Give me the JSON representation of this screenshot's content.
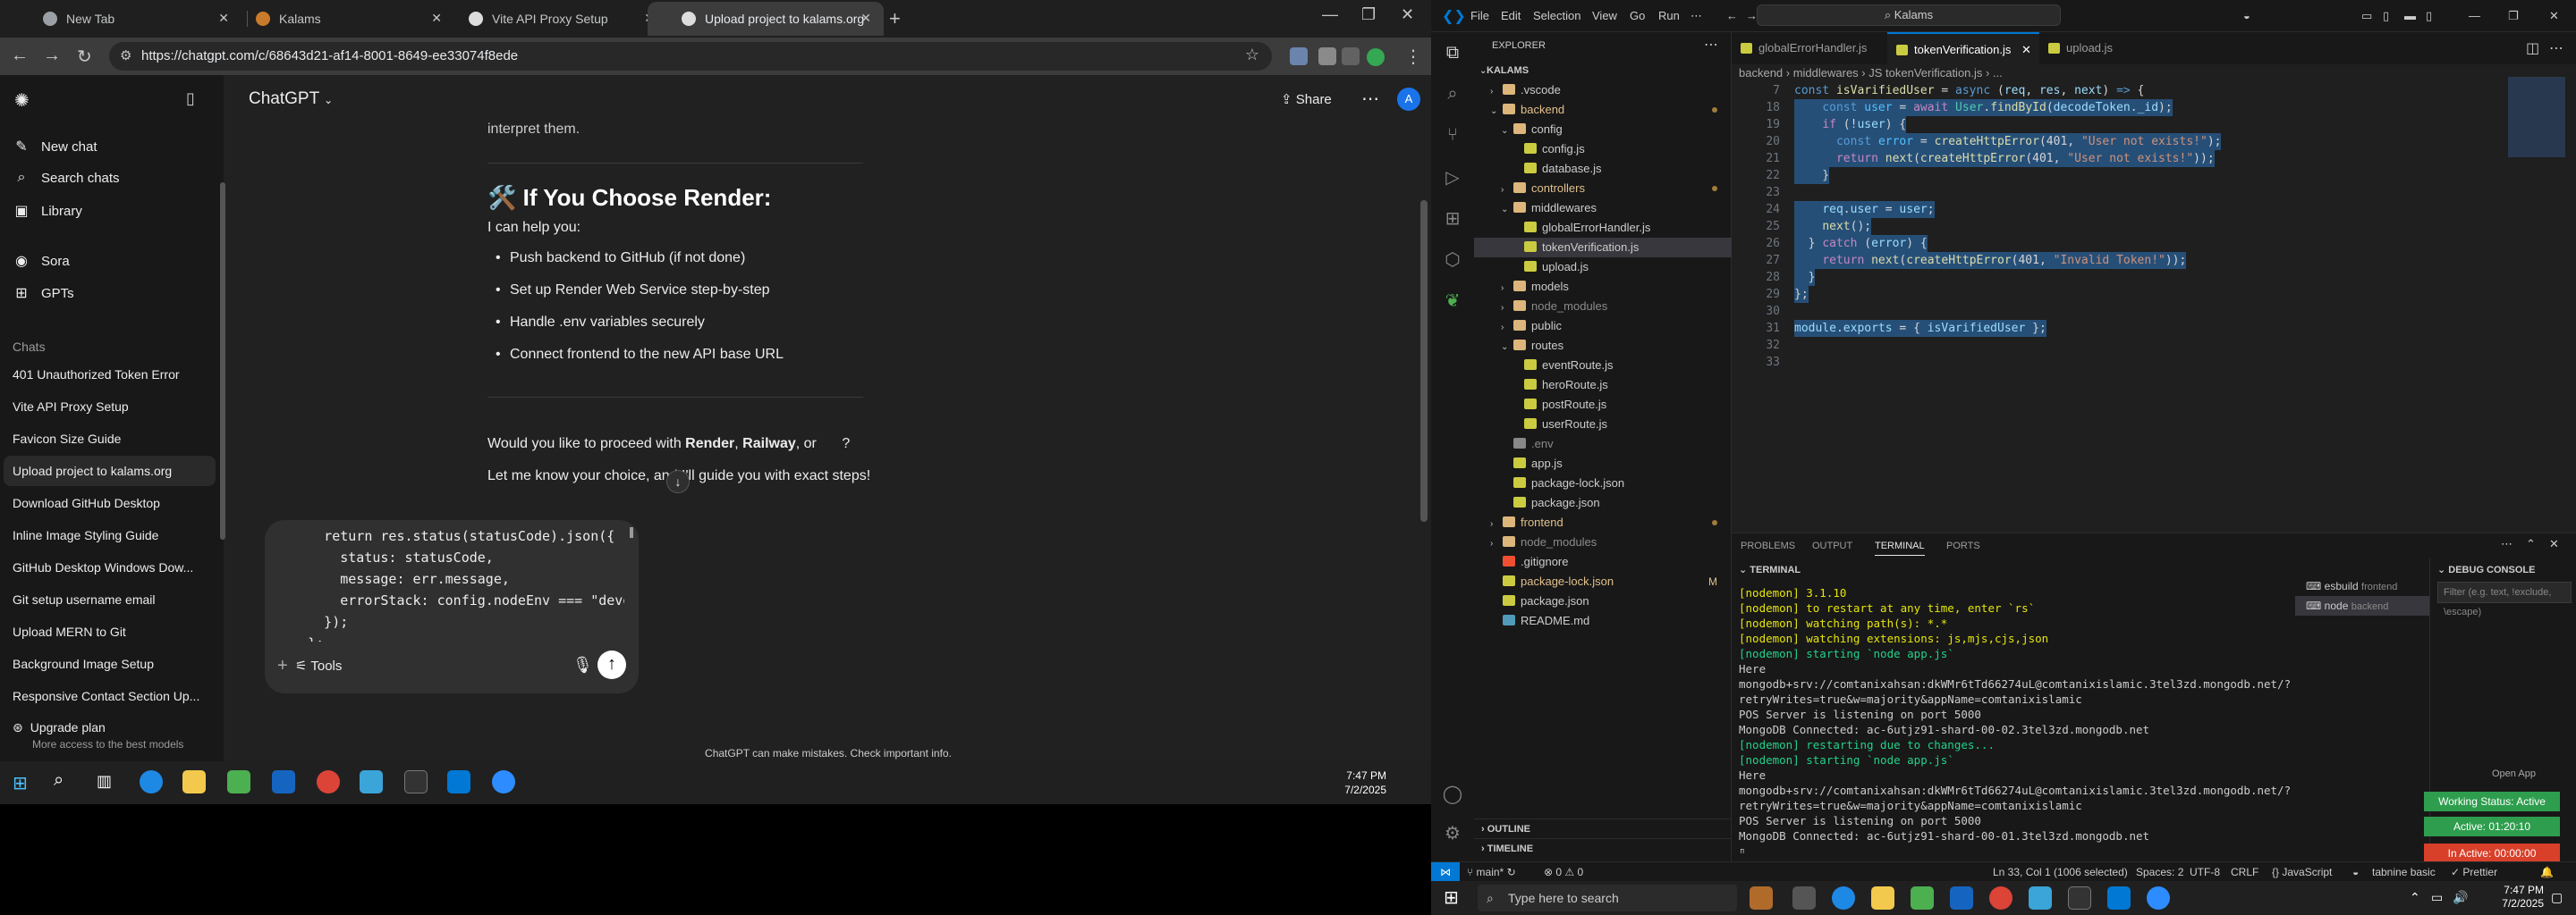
{
  "browser": {
    "tabs": [
      {
        "label": "New Tab"
      },
      {
        "label": "Kalams"
      },
      {
        "label": "Vite API Proxy Setup"
      },
      {
        "label": "Upload project to kalams.org"
      }
    ],
    "url": "https://chatgpt.com/c/68643d21-af14-8001-8649-ee33074f8ede"
  },
  "chatgpt": {
    "sidebar": {
      "new_chat": "New chat",
      "search": "Search chats",
      "library": "Library",
      "sora": "Sora",
      "gpts": "GPTs",
      "chats_header": "Chats",
      "chats": [
        "401 Unauthorized Token Error",
        "Vite API Proxy Setup",
        "Favicon Size Guide",
        "Upload project to kalams.org",
        "Download GitHub Desktop",
        "Inline Image Styling Guide",
        "GitHub Desktop Windows Dow...",
        "Git setup username email",
        "Upload MERN to Git",
        "Background Image Setup",
        "Responsive Contact Section Up..."
      ],
      "upgrade_title": "Upgrade plan",
      "upgrade_sub": "More access to the best models"
    },
    "header": {
      "title": "ChatGPT",
      "share": "Share",
      "avatar": "A"
    },
    "thread": {
      "top_fragment": "interpret them.",
      "heading": "🛠️ If You Choose Render:",
      "intro": "I can help you:",
      "bullets": [
        "Push backend to GitHub (if not done)",
        "Set up Render Web Service step-by-step",
        "Handle .env variables securely",
        "Connect frontend to the new API base URL"
      ],
      "question_prefix": "Would you like to proceed with ",
      "question_bold1": "Render",
      "question_sep": ", ",
      "question_bold2": "Railway",
      "question_tail": ", or ",
      "question_end": "?",
      "bottom_fragment": "Let me know your choice, and I'll guide you with exact steps!"
    },
    "composer": {
      "text": "      return res.status(statusCode).json({\n        status: statusCode,\n        message: err.message,\n        errorStack: config.nodeEnv === \"development\" ? err.stack : \"\",\n      });\n    };\n    module.exports = globalErrorHandler;",
      "tools": "Tools"
    },
    "disclaimer": "ChatGPT can make mistakes. Check important info."
  },
  "left_taskbar": {
    "time": "7:47 PM",
    "date": "7/2/2025"
  },
  "vscode": {
    "menu": [
      "File",
      "Edit",
      "Selection",
      "View",
      "Go",
      "Run"
    ],
    "search": "Kalams",
    "explorer_title": "EXPLORER",
    "root": "KALAMS",
    "tree": [
      {
        "label": ".vscode",
        "type": "folder",
        "depth": 1,
        "open": false
      },
      {
        "label": "backend",
        "type": "folder",
        "depth": 1,
        "open": true,
        "color": "#e2c08d",
        "dot": true
      },
      {
        "label": "config",
        "type": "folder",
        "depth": 2,
        "open": true
      },
      {
        "label": "config.js",
        "type": "js",
        "depth": 3
      },
      {
        "label": "database.js",
        "type": "js",
        "depth": 3
      },
      {
        "label": "controllers",
        "type": "folder",
        "depth": 2,
        "open": false,
        "color": "#e2c08d",
        "dot": true
      },
      {
        "label": "middlewares",
        "type": "folder",
        "depth": 2,
        "open": true
      },
      {
        "label": "globalErrorHandler.js",
        "type": "js",
        "depth": 3
      },
      {
        "label": "tokenVerification.js",
        "type": "js",
        "depth": 3,
        "selected": true
      },
      {
        "label": "upload.js",
        "type": "js",
        "depth": 3
      },
      {
        "label": "models",
        "type": "folder",
        "depth": 2,
        "open": false
      },
      {
        "label": "node_modules",
        "type": "folder",
        "depth": 2,
        "open": false,
        "color": "#8b8b8b"
      },
      {
        "label": "public",
        "type": "folder",
        "depth": 2,
        "open": false
      },
      {
        "label": "routes",
        "type": "folder",
        "depth": 2,
        "open": true
      },
      {
        "label": "eventRoute.js",
        "type": "js",
        "depth": 3
      },
      {
        "label": "heroRoute.js",
        "type": "js",
        "depth": 3
      },
      {
        "label": "postRoute.js",
        "type": "js",
        "depth": 3
      },
      {
        "label": "userRoute.js",
        "type": "js",
        "depth": 3
      },
      {
        "label": ".env",
        "type": "env",
        "depth": 2,
        "color": "#8b8b8b"
      },
      {
        "label": "app.js",
        "type": "js",
        "depth": 2
      },
      {
        "label": "package-lock.json",
        "type": "json",
        "depth": 2
      },
      {
        "label": "package.json",
        "type": "json",
        "depth": 2
      },
      {
        "label": "frontend",
        "type": "folder",
        "depth": 1,
        "open": false,
        "color": "#e2c08d",
        "dot": true
      },
      {
        "label": "node_modules",
        "type": "folder",
        "depth": 1,
        "open": false,
        "color": "#8b8b8b"
      },
      {
        "label": ".gitignore",
        "type": "git",
        "depth": 1
      },
      {
        "label": "package-lock.json",
        "type": "json",
        "depth": 1,
        "color": "#e2c08d",
        "badge": "M"
      },
      {
        "label": "package.json",
        "type": "json",
        "depth": 1
      },
      {
        "label": "README.md",
        "type": "md",
        "depth": 1
      }
    ],
    "outline": "OUTLINE",
    "timeline": "TIMELINE",
    "tabs": [
      {
        "label": "globalErrorHandler.js"
      },
      {
        "label": "tokenVerification.js"
      },
      {
        "label": "upload.js"
      }
    ],
    "breadcrumbs": "backend › middlewares › JS tokenVerification.js › ...",
    "sticky_line": {
      "num": "7"
    },
    "code_lines": [
      {
        "num": "18",
        "hl": true
      },
      {
        "num": "19",
        "hl": true
      },
      {
        "num": "20",
        "hl": true
      },
      {
        "num": "21",
        "hl": true
      },
      {
        "num": "22",
        "hl": true
      },
      {
        "num": "23",
        "hl": true
      },
      {
        "num": "24",
        "hl": true
      },
      {
        "num": "25",
        "hl": true
      },
      {
        "num": "26",
        "hl": true
      },
      {
        "num": "27",
        "hl": true
      },
      {
        "num": "28",
        "hl": true
      },
      {
        "num": "29",
        "hl": true
      },
      {
        "num": "30",
        "hl": true
      },
      {
        "num": "31",
        "hl": true
      },
      {
        "num": "32",
        "hl": true
      },
      {
        "num": "33",
        "hl": false
      }
    ],
    "panel_tabs": [
      "PROBLEMS",
      "OUTPUT",
      "TERMINAL",
      "PORTS"
    ],
    "terminal_header": "TERMINAL",
    "terminal_lines": [
      {
        "t": "[nodemon] 3.1.10",
        "c": "y"
      },
      {
        "t": "[nodemon] to restart at any time, enter `rs`",
        "c": "y"
      },
      {
        "t": "[nodemon] watching path(s): *.*",
        "c": "y"
      },
      {
        "t": "[nodemon] watching extensions: js,mjs,cjs,json",
        "c": "y"
      },
      {
        "t": "[nodemon] starting `node app.js`",
        "c": "g"
      },
      {
        "t": "Here",
        "c": ""
      },
      {
        "t": "mongodb+srv://comtanixahsan:dkWMr6tTd66274uL@comtanixislamic.3tel3zd.mongodb.net/?",
        "c": ""
      },
      {
        "t": "retryWrites=true&w=majority&appName=comtanixislamic",
        "c": ""
      },
      {
        "t": "POS Server is listening on port 5000",
        "c": ""
      },
      {
        "t": "MongoDB Connected: ac-6utjz91-shard-00-02.3tel3zd.mongodb.net",
        "c": ""
      },
      {
        "t": "[nodemon] restarting due to changes...",
        "c": "g"
      },
      {
        "t": "[nodemon] starting `node app.js`",
        "c": "g"
      },
      {
        "t": "Here",
        "c": ""
      },
      {
        "t": "mongodb+srv://comtanixahsan:dkWMr6tTd66274uL@comtanixislamic.3tel3zd.mongodb.net/?",
        "c": ""
      },
      {
        "t": "retryWrites=true&w=majority&appName=comtanixislamic",
        "c": ""
      },
      {
        "t": "POS Server is listening on port 5000",
        "c": ""
      },
      {
        "t": "MongoDB Connected: ac-6utjz91-shard-00-01.3tel3zd.mongodb.net",
        "c": ""
      },
      {
        "t": "▯",
        "c": ""
      }
    ],
    "terminal_sessions": [
      {
        "name": "esbuild",
        "sub": "frontend"
      },
      {
        "name": "node",
        "sub": "backend"
      }
    ],
    "debug_console": "DEBUG CONSOLE",
    "debug_filter": "Filter (e.g. text, !exclude, \\escape)",
    "open_app": "Open App",
    "status_pills": [
      {
        "text": "Working Status: Active",
        "color": "#2e9e4e"
      },
      {
        "text": "Active: 01:20:10",
        "color": "#2e9e4e"
      },
      {
        "text": "In Active: 00:00:00",
        "color": "#d8402a"
      }
    ],
    "statusbar": {
      "branch": "main*",
      "problems": "⊗ 0 ⚠ 0",
      "position": "Ln 33, Col 1 (1006 selected)",
      "spaces": "Spaces: 2",
      "encoding": "UTF-8",
      "eol": "CRLF",
      "lang": "{} JavaScript",
      "tabnine": "tabnine basic",
      "prettier": "✓ Prettier"
    }
  },
  "right_taskbar": {
    "search": "Type here to search",
    "time": "7:47 PM",
    "date": "7/2/2025"
  }
}
